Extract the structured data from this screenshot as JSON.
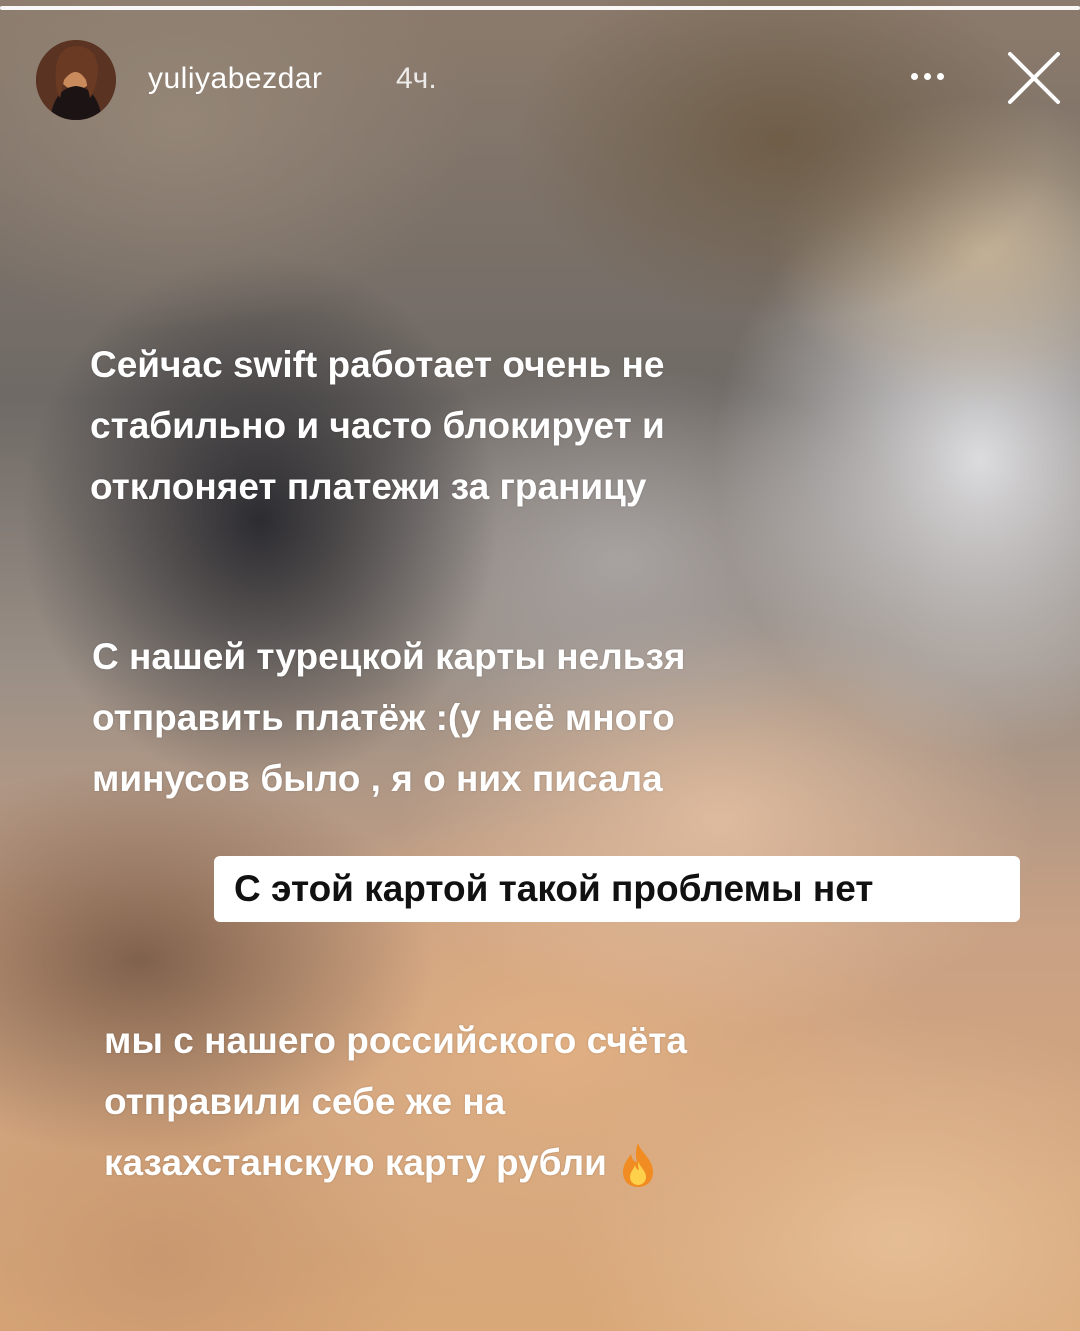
{
  "story": {
    "username": "yuliyabezdar",
    "time": "4ч.",
    "progress": {
      "segments": 3,
      "current": 3
    },
    "blocks": [
      {
        "lines": [
          "Сейчас swift работает очень не",
          "стабильно и часто блокирует и",
          "отклоняет платежи за границу"
        ]
      },
      {
        "lines": [
          "С нашей турецкой карты нельзя",
          "отправить платёж :(у неё много",
          "минусов было ,  я о них писала"
        ]
      }
    ],
    "highlight": "С этой картой такой проблемы нет",
    "final_block": {
      "lines": [
        "мы с нашего российского счёта",
        "отправили себе же на",
        "казахстанскую карту рубли"
      ],
      "emoji": "fire-icon"
    }
  }
}
